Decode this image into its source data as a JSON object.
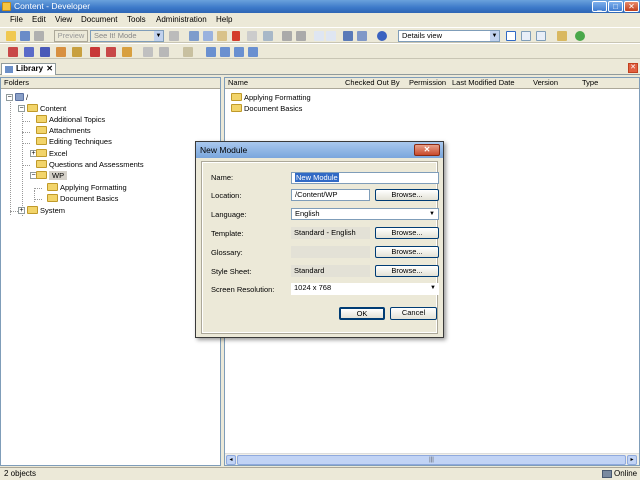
{
  "window": {
    "title": "Content - Developer",
    "controls": {
      "minimize": "_",
      "maximize": "□",
      "close": "✕"
    }
  },
  "menu": [
    "File",
    "Edit",
    "View",
    "Document",
    "Tools",
    "Administration",
    "Help"
  ],
  "toolbar": {
    "preview_label": "Preview",
    "mode_select": "See It! Mode",
    "view_select": "Details view"
  },
  "library_tab": {
    "label": "Library",
    "close": "✕"
  },
  "folders": {
    "header": "Folders",
    "tree": [
      {
        "label": "/",
        "level": 0,
        "expander": "−"
      },
      {
        "label": "Content",
        "level": 1,
        "expander": "−"
      },
      {
        "label": "Additional Topics",
        "level": 2,
        "expander": ""
      },
      {
        "label": "Attachments",
        "level": 2,
        "expander": ""
      },
      {
        "label": "Editing Techniques",
        "level": 2,
        "expander": ""
      },
      {
        "label": "Excel",
        "level": 2,
        "expander": "+"
      },
      {
        "label": "Questions and Assessments",
        "level": 2,
        "expander": ""
      },
      {
        "label": "WP",
        "level": 2,
        "expander": "−",
        "selected": true
      },
      {
        "label": "Applying Formatting",
        "level": 3,
        "expander": ""
      },
      {
        "label": "Document Basics",
        "level": 3,
        "expander": ""
      },
      {
        "label": "System",
        "level": 1,
        "expander": "+"
      }
    ]
  },
  "list": {
    "columns": [
      "Name",
      "Checked Out By",
      "Permission",
      "Last Modified Date",
      "Version",
      "Type"
    ],
    "rows": [
      "Applying Formatting",
      "Document Basics"
    ]
  },
  "dialog": {
    "title": "New Module",
    "close": "✕",
    "name_label": "Name:",
    "name_value": "New Module",
    "location_label": "Location:",
    "location_value": "/Content/WP",
    "language_label": "Language:",
    "language_value": "English",
    "template_label": "Template:",
    "template_value": "Standard - English",
    "glossary_label": "Glossary:",
    "glossary_value": "",
    "stylesheet_label": "Style Sheet:",
    "stylesheet_value": "Standard",
    "resolution_label": "Screen Resolution:",
    "resolution_value": "1024 x 768",
    "browse": "Browse...",
    "ok": "OK",
    "cancel": "Cancel"
  },
  "status": {
    "objects": "2 objects",
    "online": "Online"
  },
  "scrollbar": {
    "left": "◂",
    "right": "▸",
    "grip": "|||"
  }
}
